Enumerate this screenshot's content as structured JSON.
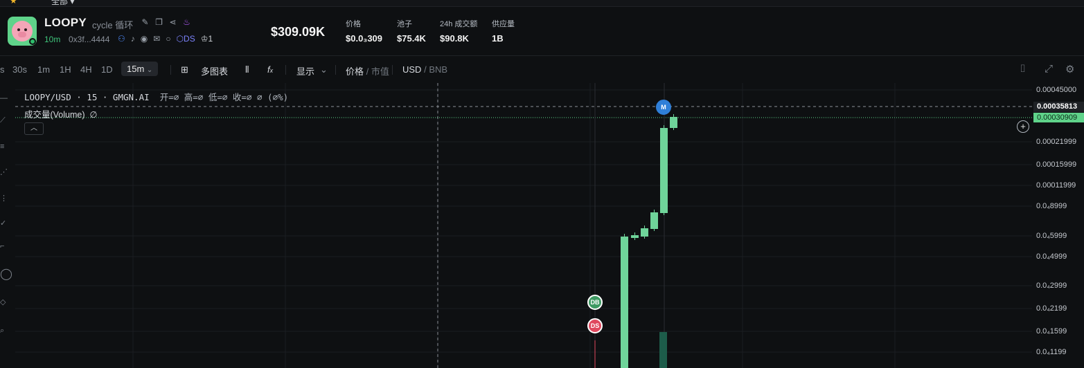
{
  "top_strip": {
    "cropped_text": "全部 ▾"
  },
  "token": {
    "name": "LOOPY",
    "tag": "cycle 循环",
    "age": "10m",
    "address": "0x3f...4444",
    "ds_label": "DS",
    "holders_count": "1"
  },
  "stats": {
    "market_cap": "$309.09K",
    "price_label": "价格",
    "price_value": "$0.0₃309",
    "pool_label": "池子",
    "pool_value": "$75.4K",
    "volume_label": "24h 成交额",
    "volume_value": "$90.8K",
    "supply_label": "供应量",
    "supply_value": "1B"
  },
  "toolbar": {
    "intervals": [
      "s",
      "30s",
      "1m",
      "1H",
      "4H",
      "1D"
    ],
    "active_interval": "15m",
    "multi_chart": "多图表",
    "display": "显示",
    "price": "价格",
    "mcap": "市值",
    "usd": "USD",
    "bnb": "BNB"
  },
  "chart": {
    "legend": "LOOPY/USD · 15 · GMGN.AI",
    "ohlc": "开=∅ 高=∅ 低=∅ 收=∅ ∅ (∅%)",
    "volume_label": "成交量(Volume)",
    "volume_value": "∅",
    "markers": {
      "m": "M",
      "db": "DB",
      "ds": "DS"
    },
    "colors": {
      "up": "#6fd49a",
      "volume": "#1d5c4a",
      "ds_marker": "#e0485e",
      "db_marker": "#3f9a63",
      "m_marker": "#2f7fd8"
    }
  },
  "price_axis": {
    "ticks": [
      "0.00045000",
      "0.00021999",
      "0.00015999",
      "0.00011999",
      "0.0₄8999",
      "0.0₄5999",
      "0.0₄4999",
      "0.0₄2999",
      "0.0₄2199",
      "0.0₄1599",
      "0.0₄1199"
    ],
    "crosshair_value": "0.00035813",
    "last_value": "0.00030909"
  }
}
